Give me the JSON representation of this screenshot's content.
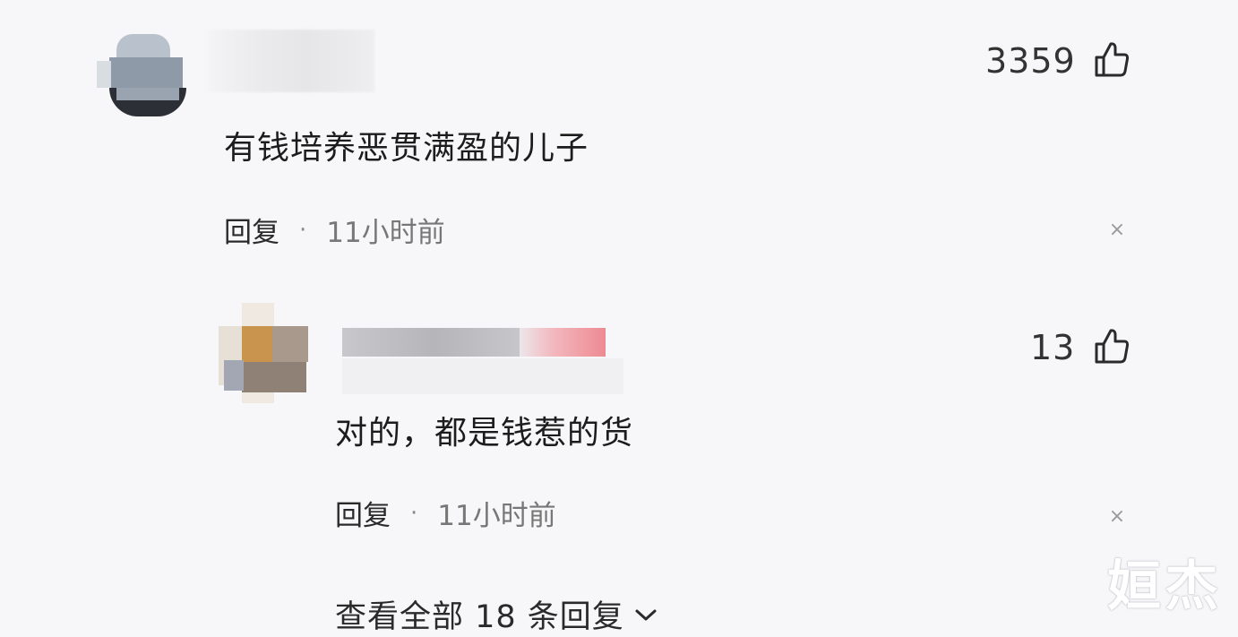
{
  "comments": [
    {
      "like_count": "3359",
      "text": "有钱培养恶贯满盈的儿子",
      "reply_label": "回复",
      "separator": "·",
      "time": "11小时前",
      "close": "×"
    },
    {
      "like_count": "13",
      "text": "对的，都是钱惹的货",
      "reply_label": "回复",
      "separator": "·",
      "time": "11小时前",
      "close": "×"
    }
  ],
  "view_all_replies": "查看全部 18 条回复",
  "watermark": "姮杰",
  "colors": {
    "background": "#f7f7f9",
    "text": "#1c1c1c",
    "muted": "#777777"
  },
  "icons": [
    "thumbs-up-icon",
    "close-icon",
    "chevron-down-icon"
  ]
}
